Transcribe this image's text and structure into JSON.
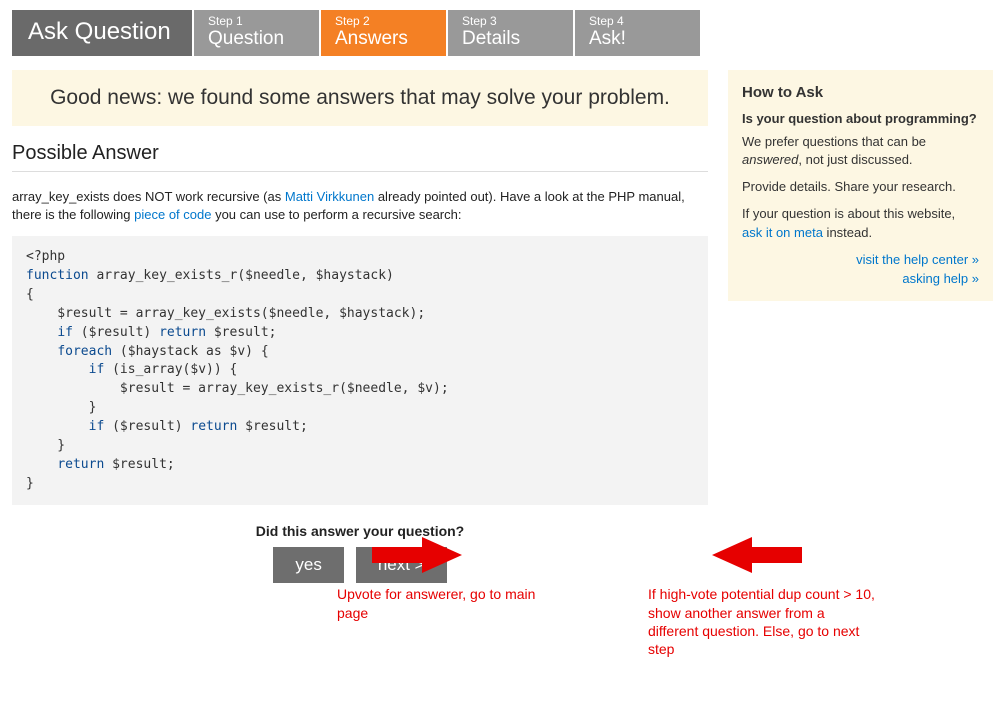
{
  "steps": {
    "title": "Ask Question",
    "items": [
      {
        "label": "Step 1",
        "name": "Question"
      },
      {
        "label": "Step 2",
        "name": "Answers"
      },
      {
        "label": "Step 3",
        "name": "Details"
      },
      {
        "label": "Step 4",
        "name": "Ask!"
      }
    ]
  },
  "banner": "Good news: we found some answers that may solve your problem.",
  "heading": "Possible Answer",
  "answer": {
    "pre1": "array_key_exists does NOT work recursive (as ",
    "link1": "Matti Virkkunen",
    "mid1": " already pointed out). Have a look at the PHP manual, there is the following ",
    "link2": "piece of code",
    "post1": " you can use to perform a recursive search:"
  },
  "code": {
    "l1": "<?php",
    "l2a": "function",
    "l2b": " array_key_exists_r($needle, $haystack)",
    "l3": "{",
    "l4": "    $result = array_key_exists($needle, $haystack);",
    "l5a": "    ",
    "l5b": "if",
    "l5c": " ($result) ",
    "l5d": "return",
    "l5e": " $result;",
    "l6a": "    ",
    "l6b": "foreach",
    "l6c": " ($haystack as $v) {",
    "l7a": "        ",
    "l7b": "if",
    "l7c": " (is_array($v)) {",
    "l8": "            $result = array_key_exists_r($needle, $v);",
    "l9": "        }",
    "l10a": "        ",
    "l10b": "if",
    "l10c": " ($result) ",
    "l10d": "return",
    "l10e": " $result;",
    "l11": "    }",
    "l12a": "    ",
    "l12b": "return",
    "l12c": " $result;",
    "l13": "}"
  },
  "prompt": "Did this answer your question?",
  "buttons": {
    "yes": "yes",
    "next": "next >"
  },
  "annotations": {
    "left": "Upvote for answerer, go to main page",
    "right": "If high-vote potential dup count > 10, show another answer from a different question. Else, go to next step"
  },
  "sidebar": {
    "title": "How to Ask",
    "q": "Is your question about programming?",
    "p1a": "We prefer questions that can be ",
    "p1em": "answered",
    "p1b": ", not just discussed.",
    "p2": "Provide details. Share your research.",
    "p3a": "If your question is about this website, ",
    "p3link": "ask it on meta",
    "p3b": " instead.",
    "link1": "visit the help center »",
    "link2": "asking help »"
  }
}
